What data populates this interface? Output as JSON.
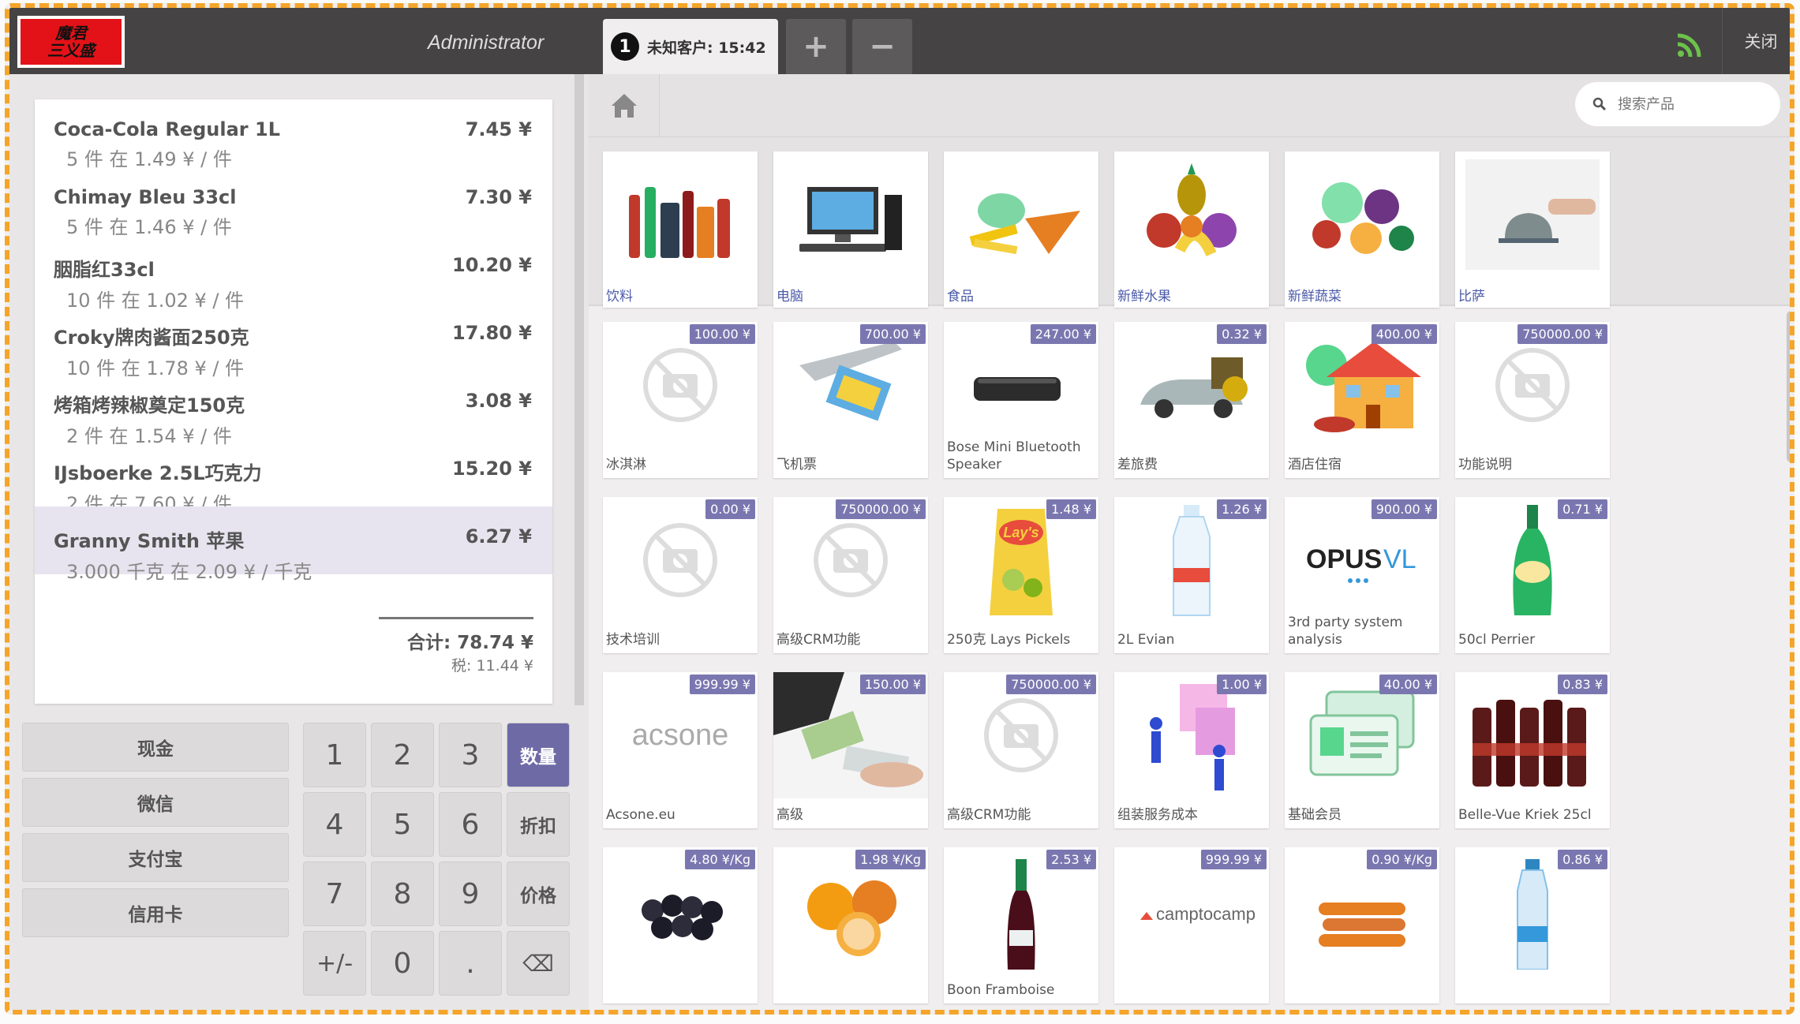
{
  "header": {
    "logo_line1": "魔君",
    "logo_line2": "三义盛",
    "user": "Administrator",
    "order_tab": {
      "number": "1",
      "label": "未知客户: 15:42"
    },
    "add_order": "+",
    "remove_order": "−",
    "close": "关闭"
  },
  "orderlines": [
    {
      "name": "Coca-Cola Regular 1L",
      "price": "7.45 ¥",
      "info": "5 件 在 1.49 ¥ / 件"
    },
    {
      "name": "Chimay Bleu 33cl",
      "price": "7.30 ¥",
      "info": "5 件 在 1.46 ¥ / 件"
    },
    {
      "name": "胭脂红33cl",
      "price": "10.20 ¥",
      "info": "10 件 在 1.02 ¥ / 件"
    },
    {
      "name": "Croky牌肉酱面250克",
      "price": "17.80 ¥",
      "info": "10 件 在 1.78 ¥ / 件"
    },
    {
      "name": "烤箱烤辣椒奠定150克",
      "price": "3.08 ¥",
      "info": "2 件 在 1.54 ¥ / 件"
    },
    {
      "name": "IJsboerke 2.5L巧克力",
      "price": "15.20 ¥",
      "info": "2 件 在 7.60 ¥ / 件"
    },
    {
      "name": "Granny Smith 苹果",
      "price": "6.27 ¥",
      "info": "3.000 千克 在 2.09 ¥ / 千克"
    }
  ],
  "summary": {
    "total": "合计: 78.74 ¥",
    "tax": "税: 11.44 ¥"
  },
  "paymethods": [
    "现金",
    "微信",
    "支付宝",
    "信用卡"
  ],
  "numpad": {
    "k1": "1",
    "k2": "2",
    "k3": "3",
    "qty": "数量",
    "k4": "4",
    "k5": "5",
    "k6": "6",
    "disc": "折扣",
    "k7": "7",
    "k8": "8",
    "k9": "9",
    "price": "价格",
    "sign": "+/-",
    "k0": "0",
    "dot": ".",
    "back": "⌫"
  },
  "search": {
    "placeholder": "搜索产品"
  },
  "categories": [
    "饮料",
    "电脑",
    "食品",
    "新鲜水果",
    "新鲜蔬菜",
    "比萨"
  ],
  "products": [
    {
      "name": "冰淇淋",
      "price": "100.00 ¥"
    },
    {
      "name": "飞机票",
      "price": "700.00 ¥"
    },
    {
      "name": "Bose Mini Bluetooth Speaker",
      "price": "247.00 ¥"
    },
    {
      "name": "差旅费",
      "price": "0.32 ¥"
    },
    {
      "name": "酒店住宿",
      "price": "400.00 ¥"
    },
    {
      "name": "功能说明",
      "price": "750000.00 ¥"
    },
    {
      "name": "技术培训",
      "price": "0.00 ¥"
    },
    {
      "name": "高级CRM功能",
      "price": "750000.00 ¥"
    },
    {
      "name": "250克 Lays Pickels",
      "price": "1.48 ¥"
    },
    {
      "name": "2L Evian",
      "price": "1.26 ¥"
    },
    {
      "name": "3rd party system analysis",
      "price": "900.00 ¥"
    },
    {
      "name": "50cl Perrier",
      "price": "0.71 ¥"
    },
    {
      "name": "Acsone.eu",
      "price": "999.99 ¥"
    },
    {
      "name": "高级",
      "price": "150.00 ¥"
    },
    {
      "name": "高级CRM功能",
      "price": "750000.00 ¥"
    },
    {
      "name": "组装服务成本",
      "price": "1.00 ¥"
    },
    {
      "name": "基础会员",
      "price": "40.00 ¥"
    },
    {
      "name": "Belle-Vue Kriek 25cl",
      "price": "0.83 ¥"
    },
    {
      "name": "",
      "price": "4.80 ¥/Kg"
    },
    {
      "name": "",
      "price": "1.98 ¥/Kg"
    },
    {
      "name": "Boon Framboise",
      "price": "2.53 ¥"
    },
    {
      "name": "",
      "price": "999.99 ¥"
    },
    {
      "name": "",
      "price": "0.90 ¥/Kg"
    },
    {
      "name": "",
      "price": "0.86 ¥"
    }
  ],
  "brand_text": {
    "opus": "OPUS",
    "vl": "VL",
    "acsone": "acsone",
    "camptocamp": "camptocamp",
    "lays": "Lay's"
  },
  "colors": {
    "accent": "#7a77b0",
    "topbar": "#454343",
    "category_text": "#4b5aa9"
  }
}
